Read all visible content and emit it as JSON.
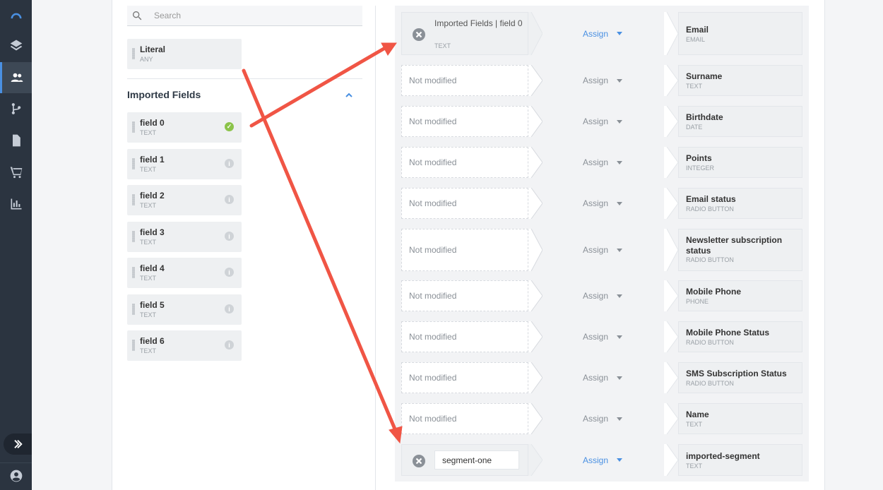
{
  "nav": {
    "items": [
      {
        "icon": "dashboard-icon"
      },
      {
        "icon": "layers-icon"
      },
      {
        "icon": "contacts-icon"
      },
      {
        "icon": "flow-icon"
      },
      {
        "icon": "document-icon"
      },
      {
        "icon": "cart-icon"
      },
      {
        "icon": "chart-icon"
      }
    ],
    "accent": "#4a90e2"
  },
  "search": {
    "placeholder": "Search",
    "value": ""
  },
  "literal": {
    "name": "Literal",
    "type": "ANY"
  },
  "imported_section": {
    "title": "Imported Fields"
  },
  "imported_fields": [
    {
      "name": "field 0",
      "type": "TEXT",
      "status": "ok"
    },
    {
      "name": "field 1",
      "type": "TEXT",
      "status": "info"
    },
    {
      "name": "field 2",
      "type": "TEXT",
      "status": "info"
    },
    {
      "name": "field 3",
      "type": "TEXT",
      "status": "info"
    },
    {
      "name": "field 4",
      "type": "TEXT",
      "status": "info"
    },
    {
      "name": "field 5",
      "type": "TEXT",
      "status": "info"
    },
    {
      "name": "field 6",
      "type": "TEXT",
      "status": "info"
    }
  ],
  "mapping": {
    "assign_label": "Assign",
    "not_modified_label": "Not modified",
    "rows": [
      {
        "source": "Imported Fields | field 0",
        "source_type": "TEXT",
        "dest": "Email",
        "dest_type": "EMAIL"
      },
      {
        "source": "",
        "source_type": "",
        "dest": "Surname",
        "dest_type": "TEXT"
      },
      {
        "source": "",
        "source_type": "",
        "dest": "Birthdate",
        "dest_type": "DATE"
      },
      {
        "source": "",
        "source_type": "",
        "dest": "Points",
        "dest_type": "INTEGER"
      },
      {
        "source": "",
        "source_type": "",
        "dest": "Email status",
        "dest_type": "RADIO BUTTON"
      },
      {
        "source": "",
        "source_type": "",
        "dest": "Newsletter subscription status",
        "dest_type": "RADIO BUTTON"
      },
      {
        "source": "",
        "source_type": "",
        "dest": "Mobile Phone",
        "dest_type": "PHONE"
      },
      {
        "source": "",
        "source_type": "",
        "dest": "Mobile Phone Status",
        "dest_type": "RADIO BUTTON"
      },
      {
        "source": "",
        "source_type": "",
        "dest": "SMS Subscription Status",
        "dest_type": "RADIO BUTTON"
      },
      {
        "source": "",
        "source_type": "",
        "dest": "Name",
        "dest_type": "TEXT"
      },
      {
        "source": "segment-one",
        "source_type": "",
        "dest": "imported-segment",
        "dest_type": "TEXT"
      }
    ]
  },
  "colors": {
    "arrow": "#f05545",
    "success": "#8bc34a"
  }
}
